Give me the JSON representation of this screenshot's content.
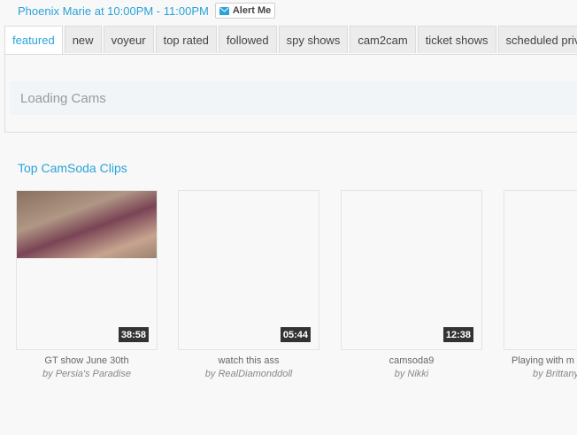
{
  "schedule": {
    "show_text": "Phoenix Marie at 10:00PM - 11:00PM",
    "alert_label": "Alert Me",
    "alert_icon": "envelope-icon"
  },
  "tabs": [
    {
      "label": "featured",
      "active": true
    },
    {
      "label": "new"
    },
    {
      "label": "voyeur"
    },
    {
      "label": "top rated"
    },
    {
      "label": "followed"
    },
    {
      "label": "spy shows"
    },
    {
      "label": "cam2cam"
    },
    {
      "label": "ticket shows"
    },
    {
      "label": "scheduled private"
    }
  ],
  "loading_text": "Loading Cams",
  "clips": {
    "heading": "Top CamSoda Clips",
    "items": [
      {
        "title": "GT show June 30th",
        "author": "by Persia's Paradise",
        "duration": "38:58"
      },
      {
        "title": "watch this ass",
        "author": "by RealDiamonddoll",
        "duration": "05:44"
      },
      {
        "title": "camsoda9",
        "author": "by Nikki",
        "duration": "12:38"
      },
      {
        "title": "Playing with m",
        "author": "by Brittany",
        "duration": ""
      }
    ]
  },
  "colors": {
    "accent": "#2aa3d8",
    "duration_bg": "#333333"
  }
}
